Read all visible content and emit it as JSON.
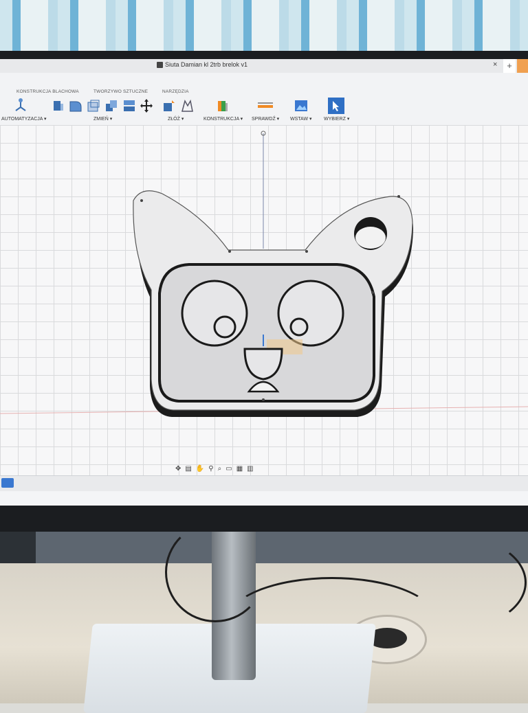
{
  "app": {
    "document_title": "Siuta Damian kl 2trb brelok v1"
  },
  "ribbon": {
    "tabs": [
      {
        "label": "KONSTRUKCJA BLACHOWA"
      },
      {
        "label": "TWORZYWO SZTUCZNE"
      },
      {
        "label": "NARZĘDZIA"
      }
    ],
    "groups": [
      {
        "label": "AUTOMATYZACJA ▾"
      },
      {
        "label": "ZMIEŃ ▾"
      },
      {
        "label": "ZŁÓŻ ▾"
      },
      {
        "label": "KONSTRUKCJA ▾"
      },
      {
        "label": "SPRAWDŹ ▾"
      },
      {
        "label": "WSTAW ▾"
      },
      {
        "label": "WYBIERZ ▾"
      }
    ],
    "icons": [
      "automation-icon",
      "extrude-icon",
      "fillet-icon",
      "shell-icon",
      "combine-icon",
      "split-icon",
      "move-icon",
      "joint-icon",
      "as-built-joint-icon",
      "plane-icon",
      "measure-icon",
      "insert-image-icon",
      "select-cursor-icon"
    ]
  },
  "canvas": {
    "model": "keychain-cat-face",
    "accent_color": "#3a78d0"
  },
  "nav_bar": {
    "icons": [
      "orbit-icon",
      "look-at-icon",
      "pan-icon",
      "zoom-icon",
      "fit-icon",
      "display-icon",
      "grid-icon",
      "viewports-icon"
    ]
  }
}
